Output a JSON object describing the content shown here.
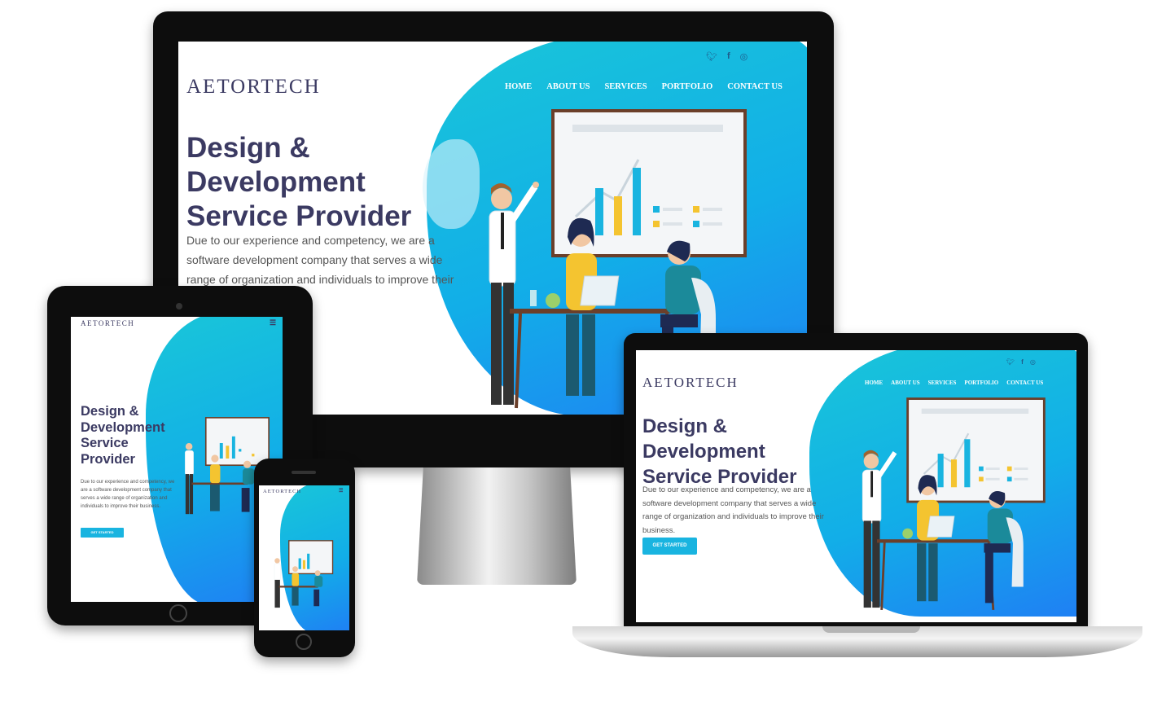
{
  "brand": "AETORTECH",
  "nav": [
    "HOME",
    "ABOUT US",
    "SERVICES",
    "PORTFOLIO",
    "CONTACT US"
  ],
  "social": [
    "twitter-icon",
    "facebook-icon",
    "instagram-icon"
  ],
  "hero": {
    "title_line1": "Design & Development",
    "title_line2": "Service Provider",
    "tablet_title_lines": [
      "Design &",
      "Development",
      "Service",
      "Provider"
    ],
    "description": "Due to our experience and competency, we are a software development company that serves a wide range of organization and individuals to improve their business.",
    "cta": "GET STARTED"
  },
  "colors": {
    "brand_text": "#3b3a62",
    "accent": "#19b4e0",
    "gradient_blue": "#1f7ff4"
  }
}
